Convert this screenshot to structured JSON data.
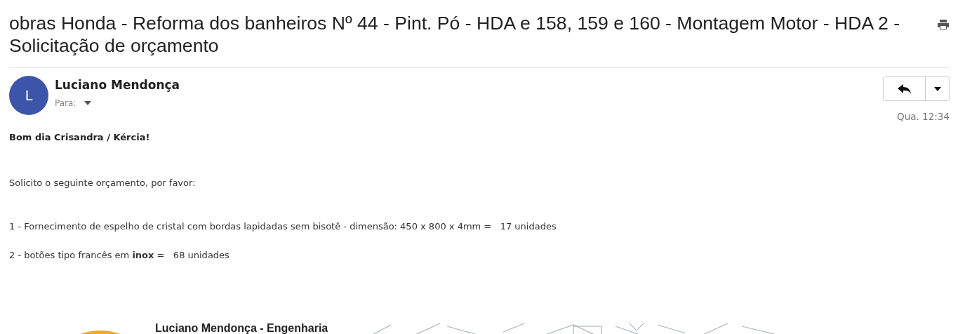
{
  "subject": "obras Honda - Reforma dos banheiros Nº 44 - Pint. Pó - HDA e 158, 159 e 160 - Montagem Motor - HDA 2 - Solicitação de orçamento",
  "sender": {
    "initial": "L",
    "name": "Luciano Mendonça",
    "to_label": "Para:",
    "time": "Qua. 12:34"
  },
  "body": [
    {
      "kind": "greeting",
      "text": "Bom dia Crisandra / Kércia!"
    },
    {
      "kind": "paragraph",
      "text": "Solicito o seguinte orçamento, por favor:"
    },
    {
      "kind": "item",
      "text": "1 - Fornecimento de espelho de cristal com bordas lapidadas sem bisotê - dimensão: 450 x 800 x 4mm =   17 unidades"
    },
    {
      "kind": "item",
      "text": "2 - botões tipo francês em **inox** =   68 unidades"
    }
  ],
  "signature": {
    "title": "Luciano Mendonça - Engenharia",
    "kind": "picture"
  }
}
